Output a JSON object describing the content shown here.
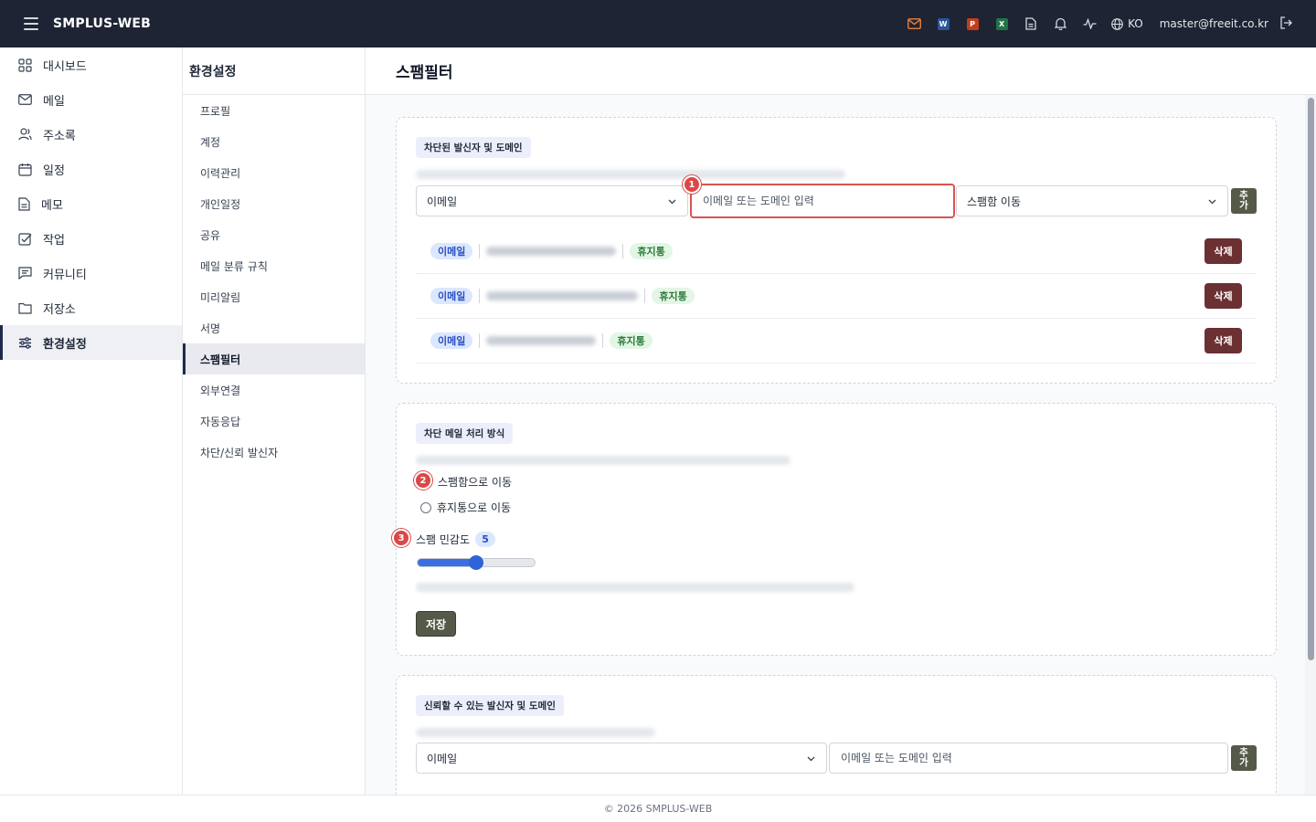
{
  "app": {
    "brand": "SMPLUS-WEB",
    "language": "KO",
    "user_email": "master@freeit.co.kr"
  },
  "topbar_icons": [
    {
      "name": "mail-icon",
      "color": "#e0773a"
    },
    {
      "name": "word-doc-icon",
      "letter": "W",
      "color": "#2b579a"
    },
    {
      "name": "powerpoint-doc-icon",
      "letter": "P",
      "color": "#c43e1c"
    },
    {
      "name": "excel-doc-icon",
      "letter": "X",
      "color": "#217346"
    },
    {
      "name": "file-icon"
    },
    {
      "name": "bell-icon"
    },
    {
      "name": "activity-icon"
    }
  ],
  "nav": {
    "items": [
      {
        "label": "대시보드",
        "icon": "dashboard-icon"
      },
      {
        "label": "메일",
        "icon": "mail-icon"
      },
      {
        "label": "주소록",
        "icon": "contacts-icon"
      },
      {
        "label": "일정",
        "icon": "calendar-icon"
      },
      {
        "label": "메모",
        "icon": "memo-icon"
      },
      {
        "label": "작업",
        "icon": "task-icon"
      },
      {
        "label": "커뮤니티",
        "icon": "community-icon"
      },
      {
        "label": "저장소",
        "icon": "folder-icon"
      },
      {
        "label": "환경설정",
        "icon": "settings-sliders-icon",
        "active": true
      }
    ]
  },
  "settings": {
    "title": "환경설정",
    "items": [
      "프로필",
      "계정",
      "이력관리",
      "개인일정",
      "공유",
      "메일 분류 규칙",
      "미리알림",
      "서명",
      "스팸필터",
      "외부연결",
      "자동응답",
      "차단/신뢰 발신자"
    ],
    "active_index": 8
  },
  "page": {
    "title": "스팸필터"
  },
  "blocked": {
    "badge": "차단된 발신자 및 도메인",
    "type_select": "이메일",
    "input_placeholder": "이메일 또는 도메인 입력",
    "action_select": "스팸함 이동",
    "add_label": "추가",
    "marker": "1",
    "rows": [
      {
        "type": "이메일",
        "dest": "휴지통",
        "delete": "삭제"
      },
      {
        "type": "이메일",
        "dest": "휴지통",
        "delete": "삭제"
      },
      {
        "type": "이메일",
        "dest": "휴지통",
        "delete": "삭제"
      }
    ]
  },
  "handling": {
    "badge": "차단 메일 처리 방식",
    "marker_option": "2",
    "option_spam": "스팸함으로 이동",
    "option_trash": "휴지통으로 이동",
    "marker_level": "3",
    "sensitivity_label": "스팸 민감도",
    "sensitivity_value": "5",
    "sensitivity_fraction": 0.5,
    "save_label": "저장"
  },
  "trusted": {
    "badge": "신뢰할 수 있는 발신자 및 도메인",
    "type_select": "이메일",
    "input_placeholder": "이메일 또는 도메인 입력",
    "add_label": "추가"
  },
  "footer": {
    "text": "© 2026 SMPLUS-WEB"
  }
}
